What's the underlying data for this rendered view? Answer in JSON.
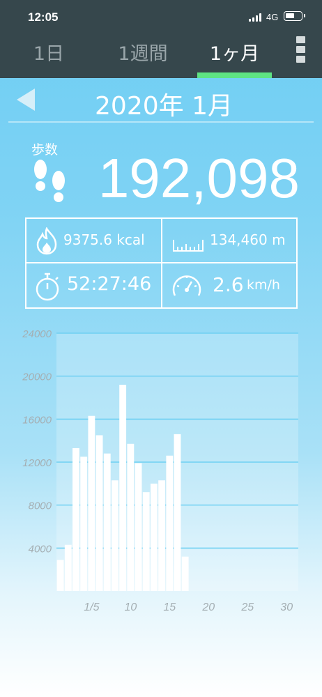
{
  "status_bar": {
    "time": "12:05",
    "network": "4G"
  },
  "tabs": [
    {
      "label": "1日",
      "active": false
    },
    {
      "label": "1週間",
      "active": false
    },
    {
      "label": "1ヶ月",
      "active": true
    }
  ],
  "colors": {
    "header_bg": "#36474c",
    "active_tab_indicator": "#5ee383",
    "bar_fill": "#ffffff",
    "grid_line": "#6fd0f2",
    "axis_label": "#a4aeb2"
  },
  "period": {
    "title": "2020年 1月"
  },
  "steps": {
    "label": "歩数",
    "value": "192,098"
  },
  "stats": {
    "calories": "9375.6 kcal",
    "distance": "134,460 m",
    "duration": "52:27:46",
    "speed_value": "2.6",
    "speed_unit": "km/h"
  },
  "icons": [
    "fire-icon",
    "ruler-icon",
    "stopwatch-icon",
    "speedometer-icon",
    "footprints-icon",
    "back-arrow-icon",
    "more-menu-icon"
  ],
  "chart_data": {
    "type": "bar",
    "x": [
      1,
      2,
      3,
      4,
      5,
      6,
      7,
      8,
      9,
      10,
      11,
      12,
      13,
      14,
      15,
      16,
      17
    ],
    "values": [
      2900,
      4300,
      13300,
      12500,
      16300,
      14500,
      12800,
      10300,
      19200,
      13700,
      11900,
      9200,
      10000,
      10300,
      12600,
      14600,
      3200
    ],
    "x_tick_labels": [
      "1/5",
      "10",
      "15",
      "20",
      "25",
      "30"
    ],
    "x_tick_positions": [
      5,
      10,
      15,
      20,
      25,
      30
    ],
    "y_ticks": [
      4000,
      8000,
      12000,
      16000,
      20000,
      24000
    ],
    "ylim": [
      0,
      24000
    ],
    "xlim": [
      0.5,
      31.5
    ],
    "title": "",
    "xlabel": "",
    "ylabel": "",
    "grid": true
  }
}
